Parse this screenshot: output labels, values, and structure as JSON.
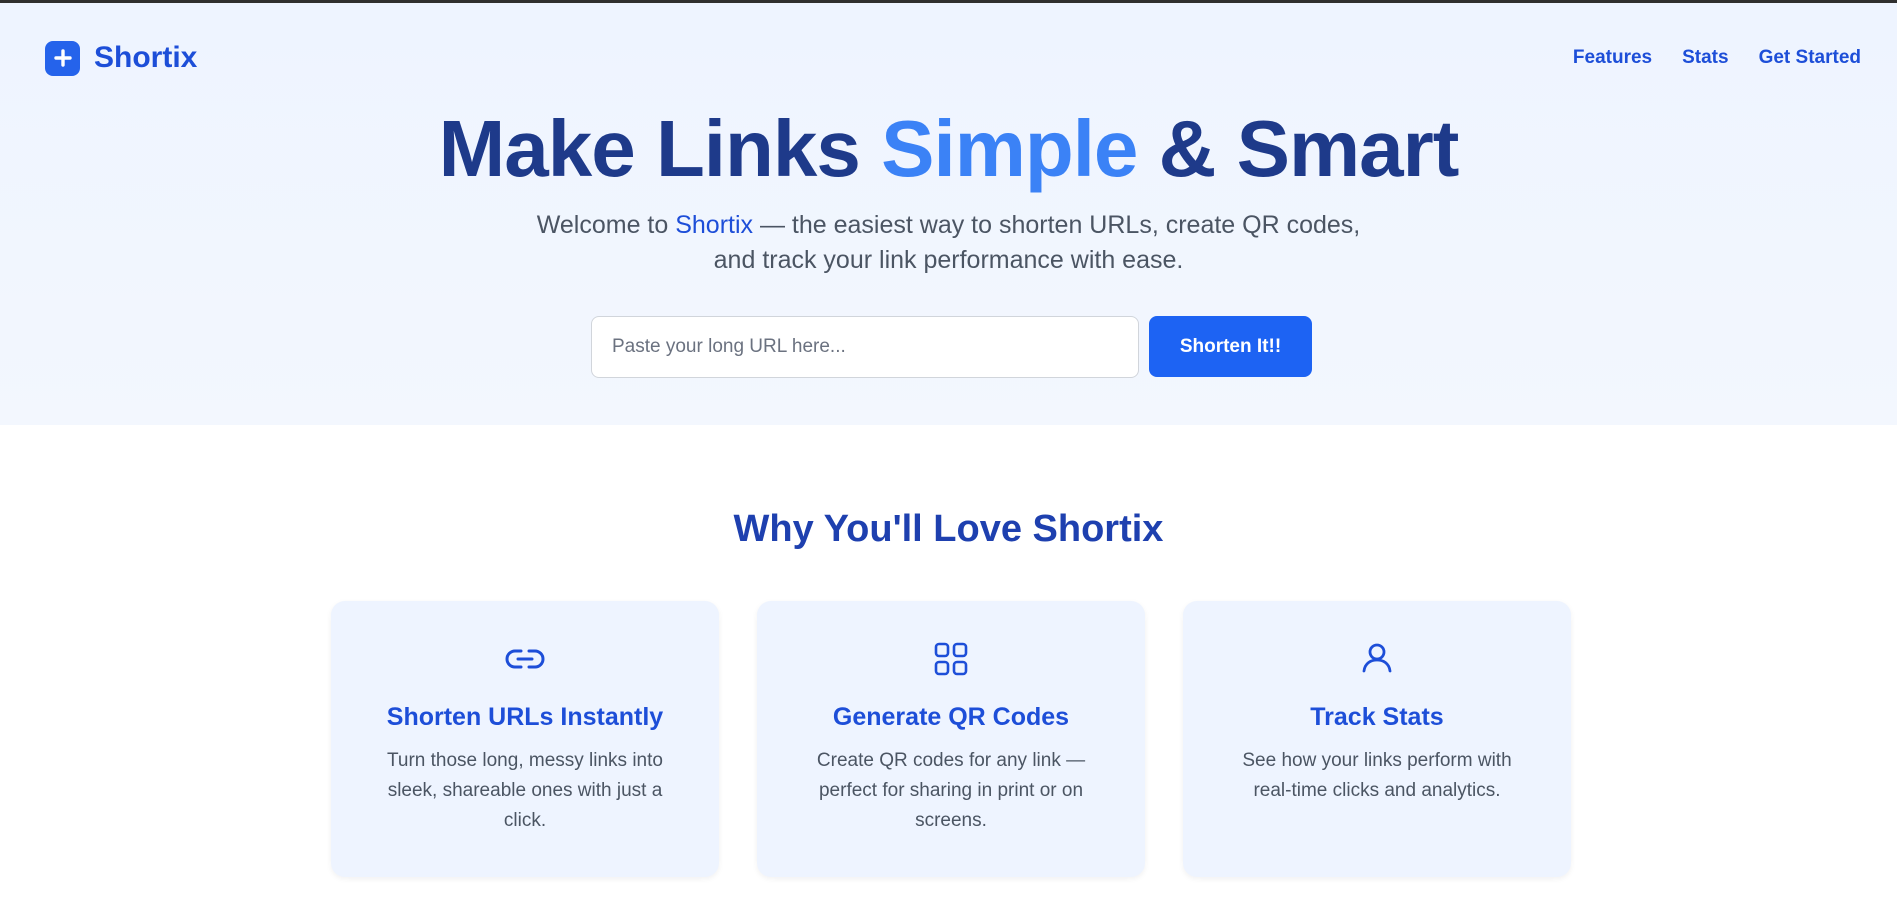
{
  "brand": {
    "name": "Shortix",
    "icon": "plus-square-icon"
  },
  "nav": {
    "features": "Features",
    "stats": "Stats",
    "get_started": "Get Started"
  },
  "hero": {
    "title_part1": "Make Links ",
    "title_highlight": "Simple",
    "title_part2": " & Smart",
    "subtitle_prefix": "Welcome to ",
    "subtitle_brand": "Shortix",
    "subtitle_line1_rest": " — the easiest way to shorten URLs, create QR codes,",
    "subtitle_line2": "and track your link performance with ease.",
    "input_placeholder": "Paste your long URL here...",
    "button_label": "Shorten It!!"
  },
  "features": {
    "title": "Why You'll Love Shortix",
    "cards": [
      {
        "icon": "link-icon",
        "title": "Shorten URLs Instantly",
        "description": "Turn those long, messy links into sleek, shareable ones with just a click."
      },
      {
        "icon": "qr-grid-icon",
        "title": "Generate QR Codes",
        "description": "Create QR codes for any link — perfect for sharing in print or on screens."
      },
      {
        "icon": "user-icon",
        "title": "Track Stats",
        "description": "See how your links perform with real-time clicks and analytics."
      }
    ]
  },
  "colors": {
    "primary": "#1d4ed8",
    "accent": "#3b82f6",
    "button": "#1d63f3",
    "heading_dark": "#1e3a8a"
  }
}
